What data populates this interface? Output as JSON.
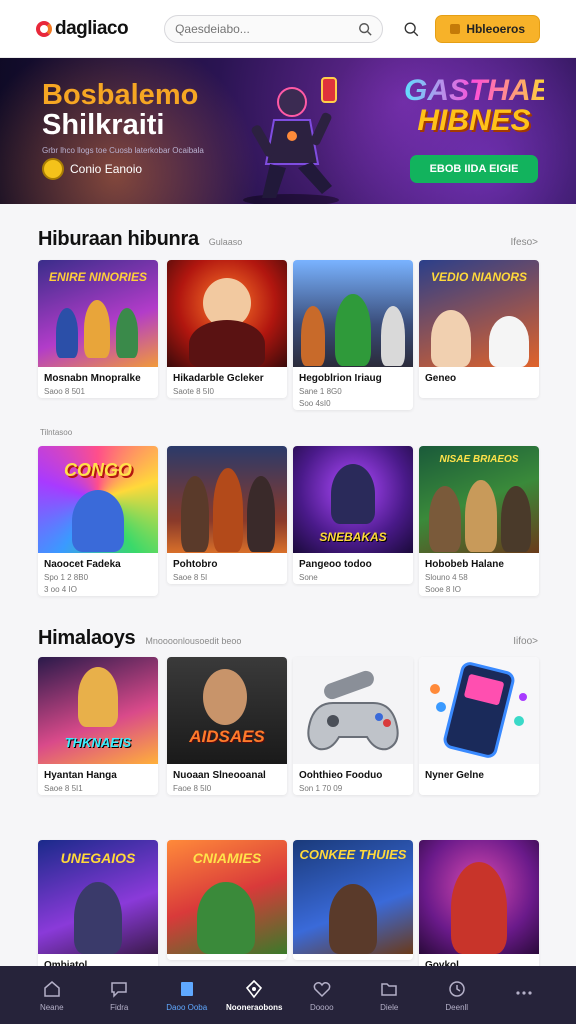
{
  "header": {
    "logo": "dagliaco",
    "search_placeholder": "Qaesdeiabo...",
    "login_label": "Hbleoeros"
  },
  "banner": {
    "title_line1": "Bosbalemo",
    "title_line2": "Shilkraiti",
    "subtitle": "Grbr lhco llogs toe Cuosb laterkobar Ocaibala",
    "brand": "Conio Eanoio",
    "logo_line1": "GASTHAEY",
    "logo_line2": "HIBNES",
    "cta_label": "EBOB IIDA EIGIE"
  },
  "section1": {
    "title": "Hiburaan hibunra",
    "note": "Gulaaso",
    "more": "Ifeso>",
    "row_caption": "Tilntasoo",
    "cards_row1": [
      {
        "name": "Mosnabn Mnopralke",
        "meta1": "Saoo 8 501",
        "meta2": ""
      },
      {
        "name": "Hikadarble Gcleker",
        "meta1": "Saote 8 5I0",
        "meta2": ""
      },
      {
        "name": "Hegoblrion Iriaug",
        "meta1": "Sane 1 8G0",
        "meta2": "Soo 4sI0"
      },
      {
        "name": "Geneo",
        "meta1": "",
        "meta2": ""
      }
    ],
    "cards_row2": [
      {
        "name": "Naoocet Fadeka",
        "meta1": "Spo 1 2 8B0",
        "meta2": "3 oo 4 IO"
      },
      {
        "name": "Pohtobro",
        "meta1": "Saoe 8 5I",
        "meta2": ""
      },
      {
        "name": "Pangeoo todoo",
        "meta1": "Sone",
        "meta2": ""
      },
      {
        "name": "Hobobeb Halane",
        "meta1": "Slouno 4 58",
        "meta2": "Sooe 8 IO"
      }
    ]
  },
  "section2": {
    "title": "Himalaoys",
    "note": "Mnoooonlousoedit beoo",
    "more": "Iifoo>",
    "cards_row1": [
      {
        "name": "Hyantan Hanga",
        "meta1": "Saoe 8 5I1",
        "meta2": ""
      },
      {
        "name": "Nuoaan Slneooanal",
        "meta1": "Faoe 8 5I0",
        "meta2": ""
      },
      {
        "name": "Oohthieo Fooduo",
        "meta1": "Son 1 70 09",
        "meta2": ""
      },
      {
        "name": "Nyner Gelne",
        "meta1": "",
        "meta2": ""
      }
    ],
    "cards_row2": [
      {
        "name": "Ombiatol",
        "meta1": "",
        "meta2": ""
      },
      {
        "name": "",
        "meta1": "",
        "meta2": ""
      },
      {
        "name": "",
        "meta1": "",
        "meta2": ""
      },
      {
        "name": "Govkol",
        "meta1": "",
        "meta2": ""
      }
    ]
  },
  "thumb_text": {
    "s1r1c1": "ENIRE NINORIES",
    "s1r1c4": "VEDIO NIANORS",
    "s1r2c1": "CONGO",
    "s1r2c3": "SNEBAKAS",
    "s1r2c4": "NISAE BRIAEOS",
    "s2r1c1": "THKNAEIS",
    "s2r1c2": "AIDSAES",
    "s2r2c1": "UNEGAIOS",
    "s2r2c2": "CNIAMIES",
    "s2r2c3": "CONKEE THUIES"
  },
  "bottom_nav": [
    {
      "label": "Neane",
      "icon": "home-icon"
    },
    {
      "label": "Fidra",
      "icon": "chat-icon"
    },
    {
      "label": "Daoo Ooba",
      "icon": "book-icon"
    },
    {
      "label": "Nooneraobons",
      "icon": "controller-icon"
    },
    {
      "label": "Doooo",
      "icon": "heart-icon"
    },
    {
      "label": "Diele",
      "icon": "folder-icon"
    },
    {
      "label": "Deenll",
      "icon": "clock-icon"
    },
    {
      "label": "",
      "icon": "more-icon"
    }
  ],
  "colors": {
    "accent": "#f7b229",
    "cta_green": "#12b35d",
    "nav_bg": "#26233a",
    "nav_active": "#5fa8ff"
  }
}
